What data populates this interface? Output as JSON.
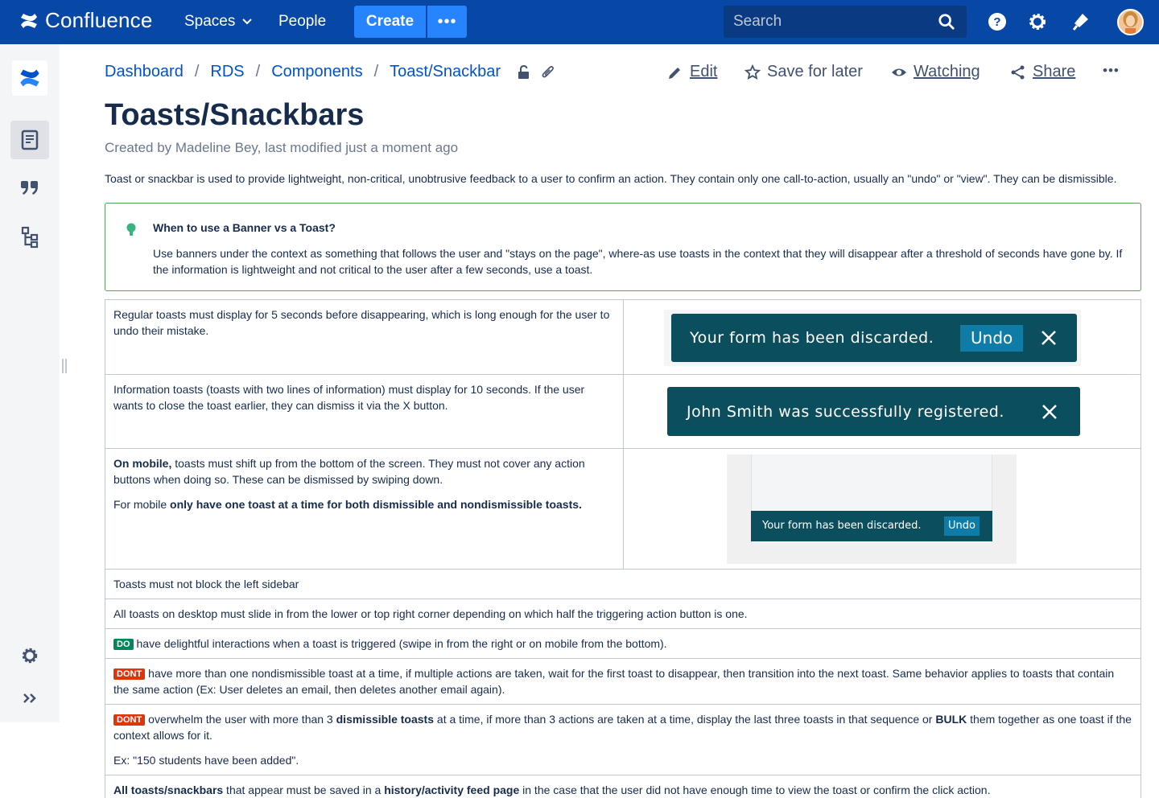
{
  "topnav": {
    "app_name": "Confluence",
    "spaces_label": "Spaces",
    "people_label": "People",
    "create_label": "Create",
    "more_label": "•••",
    "search_placeholder": "Search"
  },
  "breadcrumb": [
    "Dashboard",
    "RDS",
    "Components",
    "Toast/Snackbar"
  ],
  "actions": {
    "edit": "Edit",
    "save": "Save for later",
    "watch": "Watching",
    "share": "Share",
    "more": "•••"
  },
  "page": {
    "title": "Toasts/Snackbars",
    "byline_prefix": "Created by ",
    "author": "Madeline Bey",
    "byline_suffix": ", last modified just a moment ago",
    "intro": "Toast or snackbar is used to provide lightweight, non-critical, unobtrusive feedback to a user to confirm an action. They contain only one call-to-action, usually an \"undo\" or \"view\". They can be dismissible."
  },
  "panel": {
    "title": "When to use a Banner vs a Toast?",
    "body": "Use banners under the context as something that follows the user and \"stays on the page\", where-as use toasts in the context that they will disappear after a threshold of seconds have gone by. If the information is lightweight and not critical to the user after a few seconds, use a toast."
  },
  "rules": {
    "r1": "Regular toasts must display for 5 seconds before disappearing, which is long enough for the user to undo their mistake.",
    "r2": "Information toasts (toasts with two lines of information) must display for 10 seconds. If the user wants to close the toast earlier, they can dismiss it via the X button.",
    "r3_bold": "On mobile,",
    "r3_text": " toasts must shift up from the bottom of the screen. They must not cover any action buttons when doing so. These can be dismissed by swiping down.",
    "r3b_prefix": "For mobile ",
    "r3b_bold": "only have one toast at a time for both dismissible and nondismissible toasts.",
    "r4": "Toasts must not block the left sidebar",
    "r5": "All toasts on desktop must slide in from the lower or top right corner depending on which half the triggering action button is one.",
    "do_label": "DO",
    "r6": "have delightful interactions when a toast is triggered (swipe in from the right or on mobile from the bottom).",
    "dont_label": "DONT",
    "r7": "have more than one nondismissible toast at a time, if multiple actions are taken, wait for the first toast to disappear, then transition into the next toast. Same behavior applies to toasts that contain the same action (Ex: User deletes an email, then deletes another email again).",
    "r8_a": "overwhelm the user with more than 3 ",
    "r8_b": "dismissible toasts",
    "r8_c": " at a time, if more than 3 actions are taken at a time, display the last three toasts in that sequence or ",
    "r8_d": "BULK",
    "r8_e": " them together as one toast if the context allows for it.",
    "r8_ex": "Ex: \"150 students have been added\".",
    "r9_a": "All toasts/snackbars",
    "r9_b": " that appear must be saved in a ",
    "r9_c": "history/activity feed page",
    "r9_d": " in the case that the user did not have enough time to view the toast or confirm the click action."
  },
  "toasts": {
    "t1_msg": "Your form has been discarded.",
    "t1_action": "Undo",
    "t2_msg": "John Smith was successfully registered.",
    "mobile_msg": "Your form has been discarded.",
    "mobile_action": "Undo"
  },
  "colors": {
    "nav_bg": "#0747a6",
    "create_bg": "#2684ff",
    "toast_bg": "#0b4f5e",
    "undo_bg": "#0f7ca8",
    "panel_border": "#57a55a"
  }
}
